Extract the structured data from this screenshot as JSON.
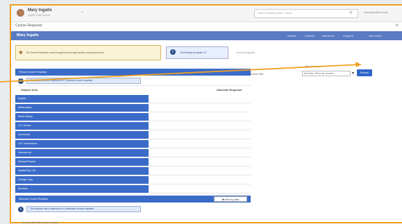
{
  "header": {
    "user_name": "Mary Ingalls",
    "user_sub": "Ingalls Public School",
    "search_placeholder": "Search students, pages, reports",
    "top_right": "maryingalls@example"
  },
  "breadcrumb": "Course Requests",
  "student_banner": {
    "title": "Mary Ingalls",
    "nav": [
      "General",
      "Contacts",
      "Attendance",
      "Programs",
      "View history"
    ]
  },
  "alert": {
    "text": "All Course Requests must be approved by appropriate school personnel"
  },
  "tabs": {
    "active": "Scheduling for grade 12",
    "other": "Course Requests"
  },
  "primary": {
    "header": "Primary Course Requests",
    "info": "This student has a maximum of 7 primary course requests",
    "filter_prefix": "Search filter",
    "filter_label": "Filter Courses",
    "filter_value": "My Area - Show all courses",
    "search_btn": "Search"
  },
  "columns": {
    "subject": "Subject Area",
    "alternate": "Alternate Requests"
  },
  "subjects": [
    "English",
    "Mathematics",
    "World History",
    "U.S. History",
    "Economics",
    "U.S. Government",
    "Science/Lab",
    "Science/Physics",
    "Health/Phys. Ed.",
    "Foreign Lang.",
    "Electives"
  ],
  "alternate": {
    "header": "Alternate Course Requests",
    "print_btn": "Print by Date",
    "info": "This student has a maximum of 4 alternate course requests",
    "footer": "No more alternate course requests"
  },
  "colors": {
    "accent": "#3a6bc9",
    "highlight": "#f0a020",
    "header_bar": "#5a7bc2"
  },
  "icons": {
    "alert": "asterisk-icon",
    "info": "info-icon",
    "search": "search-icon",
    "print": "printer-icon",
    "chevron": "chevron-down-icon"
  }
}
